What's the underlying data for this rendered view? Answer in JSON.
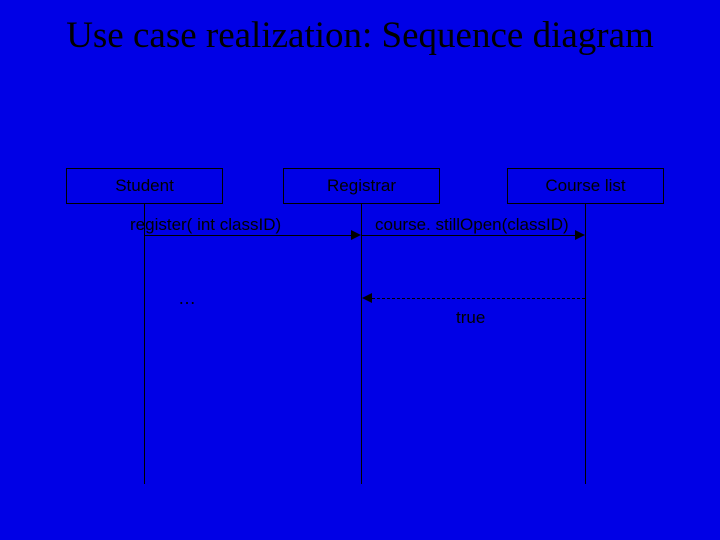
{
  "title": "Use case realization:  Sequence diagram",
  "participants": {
    "student": "Student",
    "registrar": "Registrar",
    "courselist": "Course list"
  },
  "messages": {
    "register": "register( int classID)",
    "stillopen": "course. stillOpen(classID)",
    "ellipsis": "…",
    "return_true": "true"
  }
}
